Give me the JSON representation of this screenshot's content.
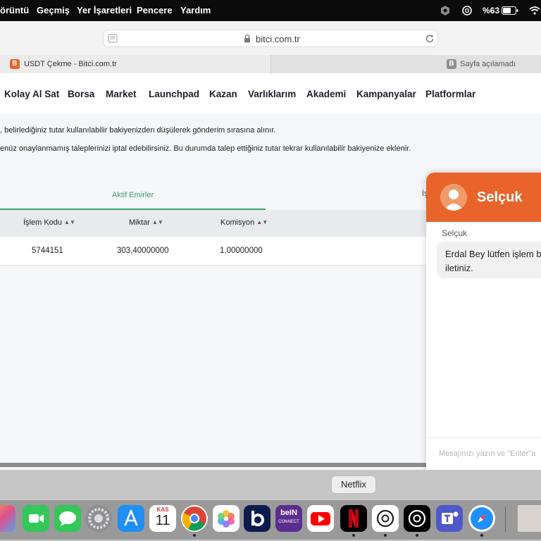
{
  "menubar": {
    "items": [
      "örüntü",
      "Geçmiş",
      "Yer İşaretleri",
      "Pencere",
      "Yardım"
    ],
    "battery_percent": "%63"
  },
  "browser": {
    "url": "bitci.com.tr",
    "tabs": [
      {
        "title": "USDT Çekme - Bitci.com.tr",
        "favicon_letter": "B"
      },
      {
        "title": "Sayfa açılamadı",
        "favicon_letter": "B"
      }
    ]
  },
  "site_nav": {
    "links": [
      "Kolay Al Sat",
      "Borsa",
      "Market",
      "Launchpad",
      "Kazan",
      "Varlıklarım",
      "Akademi",
      "Kampanyalar",
      "Platformlar"
    ]
  },
  "notices": [
    ", belirlediğiniz tutar kullanılabilir bakiyenizden düşülerek gönderim sırasına alınır.",
    "enüz onaylanmamış taleplerinizi iptal edebilirsiniz. Bu durumda talep ettiğiniz tutar tekrar kullanılabilir bakiyenize eklenir."
  ],
  "orders": {
    "tabs": [
      "Aktif Emirler",
      "İş"
    ],
    "columns": [
      "İşlem Kodu",
      "Miktar",
      "Komisyon"
    ],
    "rows": [
      {
        "code": "5744151",
        "amount": "303,40000000",
        "fee": "1,00000000"
      }
    ]
  },
  "chat": {
    "agent_name": "Selçuk",
    "sender": "Selçuk",
    "message": "Erdal Bey lütfen işlem b\niletiniz.",
    "input_placeholder": "Mesajınızı yazın ve \"Enter\"a"
  },
  "dock": {
    "tooltip": "Netflix",
    "calendar_month": "KAS",
    "calendar_day": "11",
    "bein_label": "beIN",
    "bein_sub": "CONNECT"
  },
  "colors": {
    "brand_orange": "#e8642b",
    "accent_green": "#3aa36a"
  }
}
